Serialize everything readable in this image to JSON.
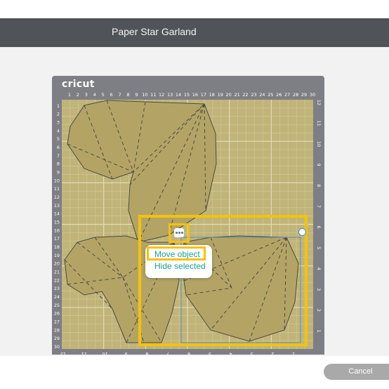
{
  "window": {
    "title": "Paper Star Garland"
  },
  "mat": {
    "brand": "cricut",
    "top_ruler": [
      "1",
      "2",
      "3",
      "4",
      "5",
      "6",
      "7",
      "8",
      "9",
      "10",
      "11",
      "12",
      "13",
      "14",
      "15",
      "16",
      "17",
      "18",
      "19",
      "20",
      "21",
      "22",
      "23",
      "24",
      "25",
      "26",
      "27",
      "28",
      "29",
      "30"
    ],
    "left_ruler": [
      "1",
      "2",
      "3",
      "4",
      "5",
      "6",
      "7",
      "8",
      "9",
      "10",
      "11",
      "12",
      "13",
      "14",
      "15",
      "16",
      "17",
      "18",
      "19",
      "20",
      "21",
      "22",
      "23",
      "24",
      "25",
      "26",
      "27",
      "28",
      "29",
      "30"
    ],
    "right_ruler": [
      "12",
      "11",
      "10",
      "9",
      "8",
      "7",
      "6",
      "5",
      "4",
      "3",
      "2",
      "1"
    ],
    "bottom_ruler": [
      "12",
      "11",
      "10",
      "9",
      "8",
      "7",
      "6",
      "5",
      "4",
      "3",
      "2",
      "1"
    ],
    "colors": {
      "mat": "#c0b478",
      "grid": "#d8d0a8",
      "shape_fill": "#b3a466",
      "shape_stroke": "#4a4a40",
      "frame": "#7d7f84"
    }
  },
  "context_menu": {
    "items": [
      "Move object",
      "Hide selected"
    ],
    "highlighted": "Move object"
  },
  "selection": {
    "menu_icon": "more-options-icon",
    "rotate_icon": "rotate-handle-icon"
  },
  "footer": {
    "cancel_label": "Cancel"
  },
  "colors": {
    "title_bar": "#505358",
    "highlight": "#f4c20d",
    "menu_text": "#1aa293",
    "cancel_button": "#a9a9a9"
  }
}
